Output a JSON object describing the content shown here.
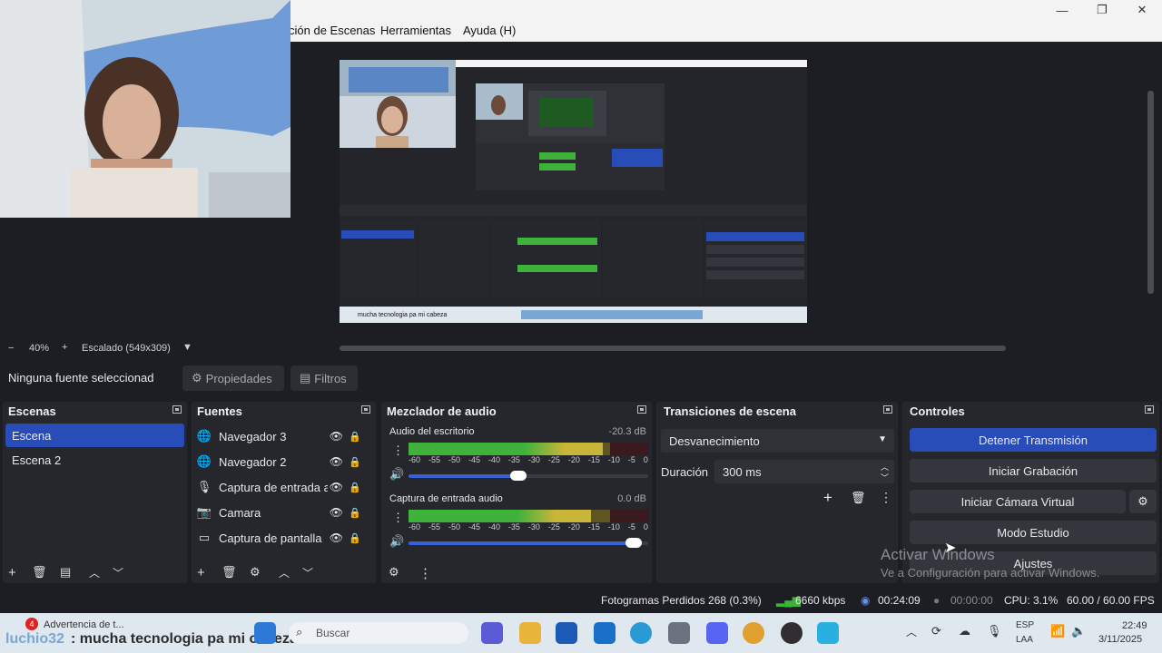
{
  "window": {
    "minimize": "—",
    "restore": "❐",
    "close": "✕"
  },
  "menu": [
    {
      "label": "ción de Escenas"
    },
    {
      "label": "Herramientas"
    },
    {
      "label": "Ayuda (H)"
    }
  ],
  "preview_caption": "mucha tecnologia pa mi cabeza",
  "zoom": {
    "minus": "−",
    "value": "40%",
    "plus": "+",
    "scale": "Escalado (549x309)"
  },
  "source_toolbar": {
    "selected": "Ninguna fuente seleccionad",
    "properties": "Propiedades",
    "filters": "Filtros"
  },
  "scenes": {
    "title": "Escenas",
    "items": [
      "Escena",
      "Escena 2"
    ]
  },
  "sources": {
    "title": "Fuentes",
    "items": [
      {
        "label": "Navegador 3",
        "icon": "globe-icon"
      },
      {
        "label": "Navegador 2",
        "icon": "globe-icon"
      },
      {
        "label": "Captura de entrada a",
        "icon": "microphone-icon"
      },
      {
        "label": "Camara",
        "icon": "camera-icon"
      },
      {
        "label": "Captura de pantalla",
        "icon": "monitor-icon"
      }
    ]
  },
  "mixer": {
    "title": "Mezclador de audio",
    "ticks": [
      "-60",
      "-55",
      "-50",
      "-45",
      "-40",
      "-35",
      "-30",
      "-25",
      "-20",
      "-15",
      "-10",
      "-5",
      "0"
    ],
    "channels": [
      {
        "name": "Audio del escritorio",
        "db": "-20.3 dB",
        "level": 0.81,
        "volume": 0.46
      },
      {
        "name": "Captura de entrada audio",
        "db": "0.0 dB",
        "level": 0.76,
        "volume": 0.94
      }
    ]
  },
  "transitions": {
    "title": "Transiciones de escena",
    "selected": "Desvanecimiento",
    "duration_label": "Duración",
    "duration_value": "300 ms"
  },
  "controls": {
    "title": "Controles",
    "stop_stream": "Detener Transmisión",
    "start_recording": "Iniciar Grabación",
    "start_virtual_cam": "Iniciar Cámara Virtual",
    "studio_mode": "Modo Estudio",
    "settings": "Ajustes"
  },
  "watermark": {
    "line1": "Activar Windows",
    "line2": "Ve a Configuración para activar Windows."
  },
  "status": {
    "dropped_frames": "Fotogramas Perdidos 268 (0.3%)",
    "bitrate": "6660 kbps",
    "stream_time": "00:24:09",
    "rec_time": "00:00:00",
    "cpu": "CPU: 3.1%",
    "fps": "60.00 / 60.00 FPS"
  },
  "taskbar": {
    "notification": "Advertencia de t...",
    "notification_count": "4",
    "chat_user": "luchio32",
    "chat_message": ": mucha tecnologia pa mi cabeza",
    "search_placeholder": "Buscar",
    "lang": "ESP",
    "lang2": "LAA",
    "time": "22:49",
    "date": "3/11/2025"
  }
}
